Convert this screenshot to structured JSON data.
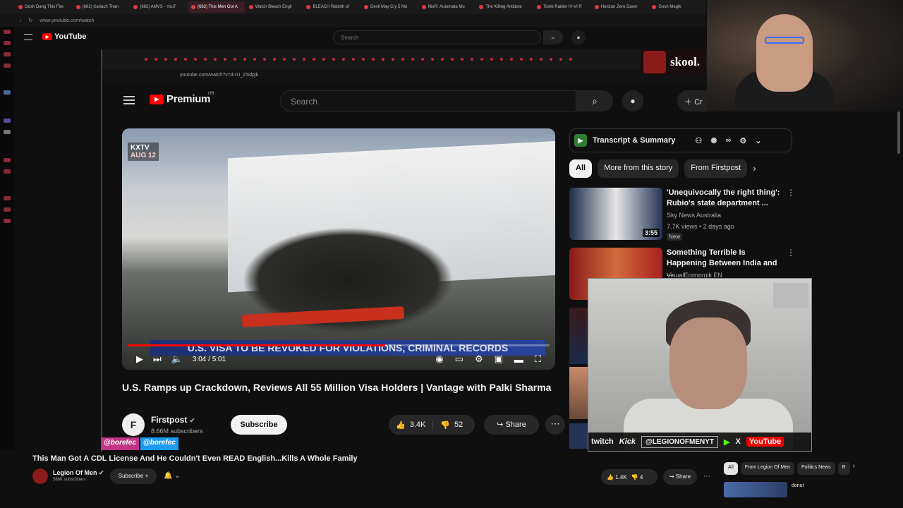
{
  "outer_browser": {
    "tabs": [
      "Oosh Dang This Fire",
      "(682) Kariach Than",
      "(682) AMVS - YouT",
      "(682) This Men Got A",
      "Watch Bleach Engli",
      "BLEACH Rebirth of",
      "Devil May Cry 5 Mo",
      "NieR: Automata Mo",
      "The Killing Antidote",
      "Tomb Raider IV-VI R",
      "Horizon Zero Dawn",
      "Gosh Magik"
    ],
    "active_tab_index": 3,
    "url": "www.youtube.com/watch",
    "logo": "YouTube",
    "search_placeholder": "Search"
  },
  "inner_browser": {
    "url": "youtube.com/watch?v=d-rU_ZSdpjk",
    "logo": "Premium",
    "logo_badge": "HR",
    "search_placeholder": "Search",
    "create_label": "Cr"
  },
  "video": {
    "watermark": "KXTV",
    "watermark_date": "AUG 12",
    "chyron": "U.S. VISA TO BE REVOKED FOR VIOLATIONS, CRIMINAL RECORDS",
    "time": "3:04 / 5:01",
    "progress": 0.61,
    "title": "U.S. Ramps up Crackdown, Reviews All 55 Million Visa Holders | Vantage with Palki Sharma",
    "channel": "Firstpost",
    "channel_initial": "F",
    "subscribers": "8.66M subscribers",
    "subscribe_label": "Subscribe",
    "likes": "3.4K",
    "dislikes": "52",
    "share_label": "Share"
  },
  "sidebar_panel": {
    "transcript_label": "Transcript & Summary",
    "chips": [
      "All",
      "More from this story",
      "From Firstpost"
    ],
    "recommendations": [
      {
        "title": "'Unequivocally the right thing': Rubio's state department ...",
        "channel": "Sky News Australia",
        "meta": "7.7K views • 2 days ago",
        "badge": "New",
        "duration": "3:55"
      },
      {
        "title": "Something Terrible Is Happening Between India and ...",
        "channel": "VisualEconomik EN",
        "meta": "",
        "badge": "",
        "duration": ""
      }
    ]
  },
  "overlays": {
    "skool": "skool.",
    "social_handles": [
      "@borefec",
      "@borefec"
    ],
    "stream_bar": {
      "twitch": "twitch",
      "kick": "Kick",
      "handle": "@LEGIONOFMENYT",
      "x": "X",
      "youtube": "YouTube"
    }
  },
  "outer_video": {
    "title": "This Man Got A CDL License And He Couldn't Even READ English...Kills A Whole Family",
    "channel": "Legion Of Men",
    "subscribers": "586K subscribers",
    "subscribe_label": "Subscribe",
    "likes": "1.4K",
    "dislikes": "4",
    "share_label": "Share",
    "chips": [
      "All",
      "From Legion Of Men",
      "Politics News",
      "R"
    ],
    "rec_channel": "donut"
  }
}
